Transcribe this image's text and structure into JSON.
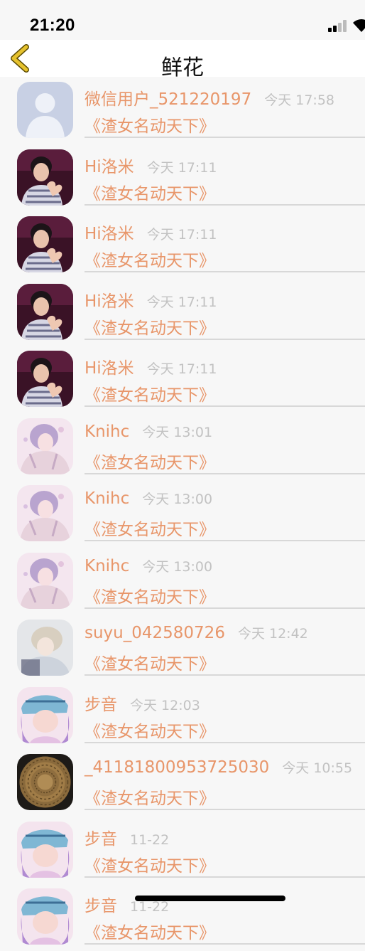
{
  "status_bar": {
    "time": "21:20"
  },
  "nav": {
    "title": "鲜花",
    "back_icon": "chevron-left-icon"
  },
  "colors": {
    "accent": "#e8966a",
    "timestamp": "#c2c2c2",
    "back_arrow": "#e6c22e"
  },
  "avatar_kinds": {
    "default": "default-avatar",
    "a": "photo-avatar-heart-hands",
    "b": "anime-avatar-pink",
    "c": "anime-avatar-pale",
    "d": "anime-avatar-blue-hat",
    "e": "woven-basket-avatar"
  },
  "list": [
    {
      "avatar": "default",
      "name": "微信用户_521220197",
      "time": "今天 17:58",
      "book": "《渣女名动天下》"
    },
    {
      "avatar": "a",
      "name": "Hi洛米",
      "time": "今天 17:11",
      "book": "《渣女名动天下》"
    },
    {
      "avatar": "a",
      "name": "Hi洛米",
      "time": "今天 17:11",
      "book": "《渣女名动天下》"
    },
    {
      "avatar": "a",
      "name": "Hi洛米",
      "time": "今天 17:11",
      "book": "《渣女名动天下》"
    },
    {
      "avatar": "a",
      "name": "Hi洛米",
      "time": "今天 17:11",
      "book": "《渣女名动天下》"
    },
    {
      "avatar": "b",
      "name": "Knihc",
      "time": "今天 13:01",
      "book": "《渣女名动天下》"
    },
    {
      "avatar": "b",
      "name": "Knihc",
      "time": "今天 13:00",
      "book": "《渣女名动天下》"
    },
    {
      "avatar": "b",
      "name": "Knihc",
      "time": "今天 13:00",
      "book": "《渣女名动天下》"
    },
    {
      "avatar": "c",
      "name": "suyu_042580726",
      "time": "今天 12:42",
      "book": "《渣女名动天下》"
    },
    {
      "avatar": "d",
      "name": "步音",
      "time": "今天 12:03",
      "book": "《渣女名动天下》"
    },
    {
      "avatar": "e",
      "name": "_41181800953725030",
      "time": "今天 10:55",
      "book": "《渣女名动天下》"
    },
    {
      "avatar": "d",
      "name": "步音",
      "time": "11-22",
      "book": "《渣女名动天下》"
    },
    {
      "avatar": "d",
      "name": "步音",
      "time": "11-22",
      "book": "《渣女名动天下》"
    }
  ]
}
